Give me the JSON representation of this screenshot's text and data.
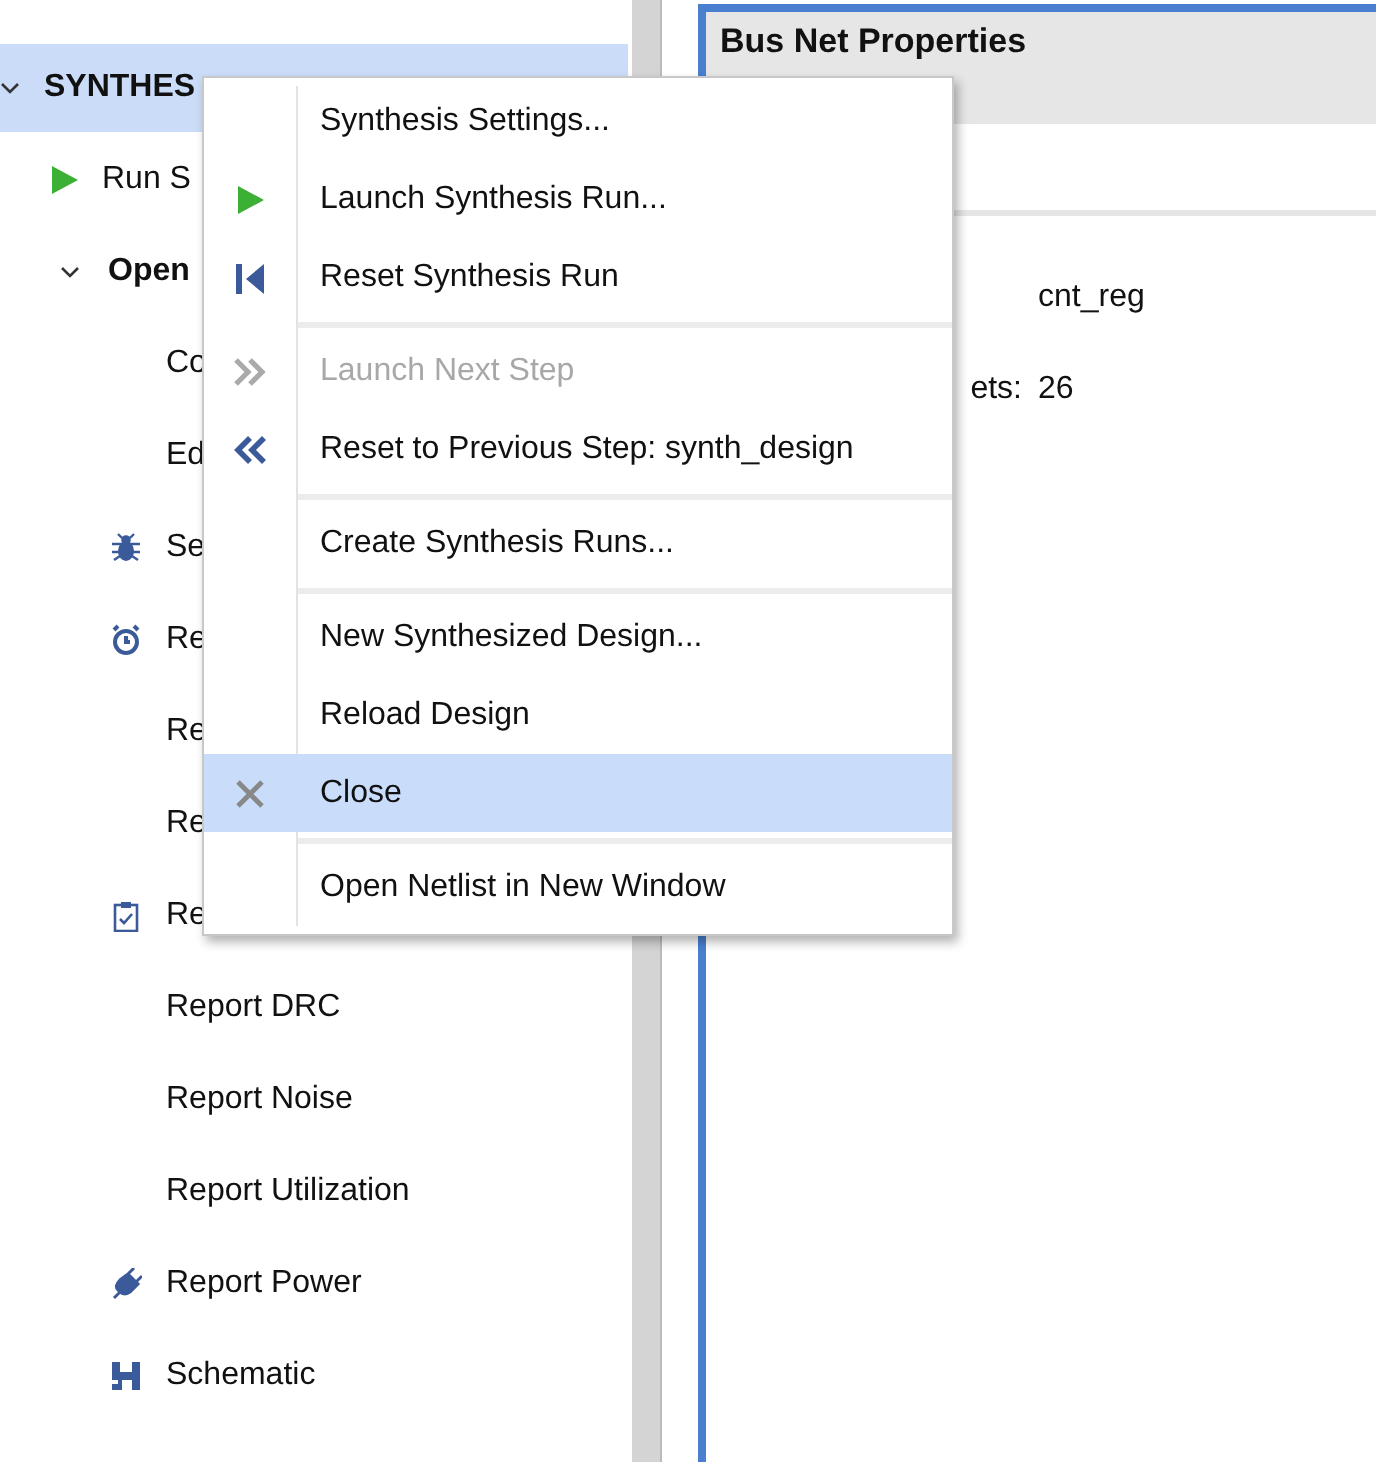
{
  "tree": [
    {
      "label": "SYNTHES",
      "selected": true,
      "expanded": true,
      "children": [
        {
          "label": "Run S",
          "selected": false
        },
        {
          "label": "Open",
          "selected": false,
          "expanded": true,
          "children": [
            {
              "label": "Co",
              "selected": false
            },
            {
              "label": "Ed",
              "selected": false
            },
            {
              "label": "Se",
              "selected": false
            },
            {
              "label": "Re",
              "selected": false
            },
            {
              "label": "Re",
              "selected": false
            },
            {
              "label": "Re",
              "selected": false
            },
            {
              "label": "Re",
              "selected": false
            },
            {
              "label": "Report DRC",
              "selected": false
            },
            {
              "label": "Report Noise",
              "selected": false
            },
            {
              "label": "Report Utilization",
              "selected": false
            },
            {
              "label": "Report Power",
              "selected": false
            },
            {
              "label": "Schematic",
              "selected": false
            }
          ]
        }
      ]
    }
  ],
  "properties": {
    "title": "Bus Net Properties",
    "rows": [
      {
        "label": "",
        "value": "cnt_reg"
      },
      {
        "label": "ets:",
        "value": "26"
      }
    ]
  },
  "context_menu": [
    {
      "kind": "item",
      "label": "Synthesis Settings...",
      "disabled": false,
      "selected": false
    },
    {
      "kind": "item",
      "label": "Launch Synthesis Run...",
      "disabled": false,
      "selected": false
    },
    {
      "kind": "item",
      "label": "Reset Synthesis Run",
      "disabled": false,
      "selected": false
    },
    {
      "kind": "separator"
    },
    {
      "kind": "item",
      "label": "Launch Next Step",
      "disabled": true,
      "selected": false
    },
    {
      "kind": "item",
      "label": "Reset to Previous Step: synth_design",
      "disabled": false,
      "selected": false
    },
    {
      "kind": "separator"
    },
    {
      "kind": "item",
      "label": "Create Synthesis Runs...",
      "disabled": false,
      "selected": false
    },
    {
      "kind": "separator"
    },
    {
      "kind": "item",
      "label": "New Synthesized Design...",
      "disabled": false,
      "selected": false
    },
    {
      "kind": "item",
      "label": "Reload Design",
      "disabled": false,
      "selected": false
    },
    {
      "kind": "item",
      "label": "Close",
      "disabled": false,
      "selected": true
    },
    {
      "kind": "separator"
    },
    {
      "kind": "item",
      "label": "Open Netlist in New Window",
      "disabled": false,
      "selected": false
    }
  ]
}
